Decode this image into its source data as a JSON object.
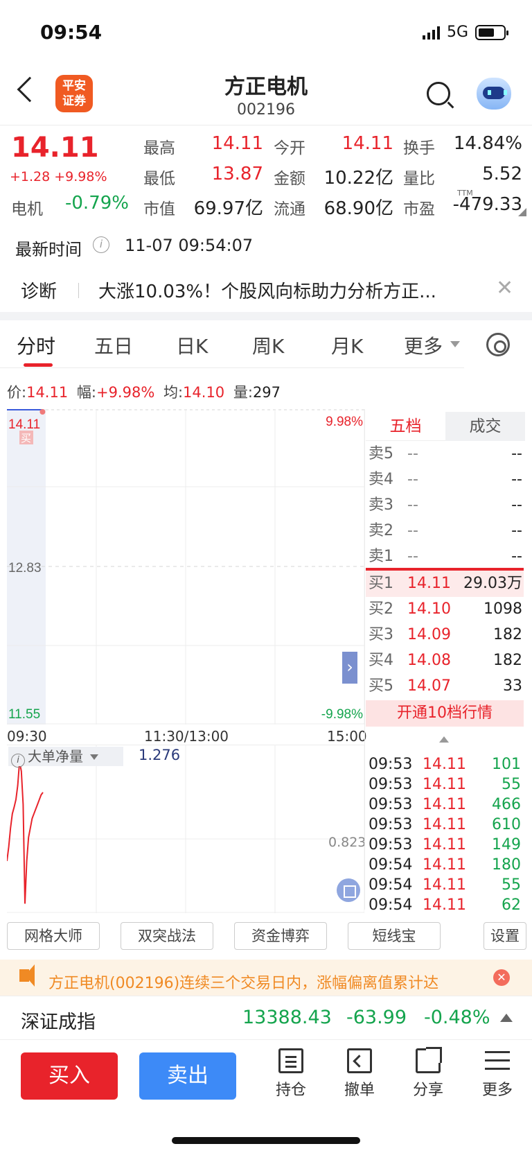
{
  "status_bar": {
    "time": "09:54",
    "network": "5G"
  },
  "header": {
    "logo_text_1": "平安",
    "logo_text_2": "证券",
    "stock_name": "方正电机",
    "stock_code": "002196"
  },
  "quote": {
    "price": "14.11",
    "change": "+1.28 +9.98%",
    "sector_label": "电机",
    "sector_change": "-0.79%",
    "fields": [
      {
        "label": "最高",
        "value": "14.11",
        "color": "#e8232b"
      },
      {
        "label": "今开",
        "value": "14.11",
        "color": "#e8232b"
      },
      {
        "label": "换手",
        "value": "14.84%",
        "color": "#222222"
      },
      {
        "label": "最低",
        "value": "13.87",
        "color": "#e8232b"
      },
      {
        "label": "金额",
        "value": "10.22亿",
        "color": "#222222"
      },
      {
        "label": "量比",
        "value": "5.52",
        "color": "#222222"
      },
      {
        "label": "市值",
        "value": "69.97亿",
        "color": "#222222"
      },
      {
        "label": "流通",
        "value": "68.90亿",
        "color": "#222222"
      },
      {
        "label": "市盈",
        "value": "-479.33",
        "color": "#222222"
      }
    ],
    "pe_superscript": "TTM"
  },
  "latest": {
    "label": "最新时间",
    "time": "11-07 09:54:07"
  },
  "diagnosis": {
    "label": "诊断",
    "text": "大涨10.03%！个股风向标助力分析方正..."
  },
  "tabs": [
    {
      "label": "分时",
      "active": true
    },
    {
      "label": "五日"
    },
    {
      "label": "日K"
    },
    {
      "label": "周K"
    },
    {
      "label": "月K"
    },
    {
      "label": "更多"
    }
  ],
  "infobar": {
    "price_label": "价:",
    "price_value": "14.11",
    "range_label": "幅:",
    "range_value": "+9.98%",
    "avg_label": "均:",
    "avg_value": "14.10",
    "vol_label": "量:",
    "vol_value": "297"
  },
  "chart_data": {
    "type": "line",
    "y_top": "14.11",
    "y_mid": "12.83",
    "y_bottom": "11.55",
    "pct_top": "9.98%",
    "pct_bottom": "-9.98%",
    "buy_marker": "买",
    "ylim": [
      11.55,
      14.11
    ],
    "x_labels": [
      "09:30",
      "11:30/13:00",
      "15:00"
    ],
    "series": [
      {
        "x": [
          0,
          1,
          2,
          3,
          4,
          5,
          6,
          7,
          8,
          9,
          10,
          11,
          12,
          13,
          14,
          15,
          16,
          17,
          18,
          19,
          20,
          21,
          22,
          23,
          24
        ],
        "values": [
          14.11,
          14.11,
          14.11,
          14.11,
          14.11,
          14.11,
          14.11,
          14.11,
          14.11,
          14.11,
          14.11,
          14.11,
          14.11,
          14.11,
          14.11,
          14.11,
          14.11,
          14.11,
          14.11,
          14.11,
          14.11,
          14.11,
          14.11,
          14.11,
          14.11
        ]
      }
    ],
    "sub_chart": {
      "indicator": "大单净量",
      "value": "1.276",
      "axis_value": "0.823",
      "values": [
        0.55,
        0.7,
        0.9,
        1.05,
        1.12,
        1.2,
        1.35,
        1.6,
        1.5,
        1.15,
        0.1,
        0.55,
        0.8,
        0.9,
        1.0,
        1.05,
        1.1,
        1.15,
        1.2,
        1.25,
        1.276
      ],
      "ylim": [
        0.0,
        1.7
      ]
    }
  },
  "orderbook": {
    "tab_active": "五档",
    "tab_other": "成交",
    "asks": [
      {
        "label": "卖5",
        "price": "--",
        "vol": "--"
      },
      {
        "label": "卖4",
        "price": "--",
        "vol": "--"
      },
      {
        "label": "卖3",
        "price": "--",
        "vol": "--"
      },
      {
        "label": "卖2",
        "price": "--",
        "vol": "--"
      },
      {
        "label": "卖1",
        "price": "--",
        "vol": "--"
      }
    ],
    "bids": [
      {
        "label": "买1",
        "price": "14.11",
        "vol": "29.03万"
      },
      {
        "label": "买2",
        "price": "14.10",
        "vol": "1098"
      },
      {
        "label": "买3",
        "price": "14.09",
        "vol": "182"
      },
      {
        "label": "买4",
        "price": "14.08",
        "vol": "182"
      },
      {
        "label": "买5",
        "price": "14.07",
        "vol": "33"
      }
    ],
    "open10": "开通10档行情"
  },
  "trades": [
    {
      "time": "09:53",
      "price": "14.11",
      "vol": "101"
    },
    {
      "time": "09:53",
      "price": "14.11",
      "vol": "55"
    },
    {
      "time": "09:53",
      "price": "14.11",
      "vol": "466"
    },
    {
      "time": "09:53",
      "price": "14.11",
      "vol": "610"
    },
    {
      "time": "09:53",
      "price": "14.11",
      "vol": "149"
    },
    {
      "time": "09:54",
      "price": "14.11",
      "vol": "180"
    },
    {
      "time": "09:54",
      "price": "14.11",
      "vol": "55"
    },
    {
      "time": "09:54",
      "price": "14.11",
      "vol": "62"
    }
  ],
  "tools": [
    "网格大师",
    "双突战法",
    "资金博弈",
    "短线宝",
    "设置"
  ],
  "notice": {
    "text": "方正电机(002196)连续三个交易日内，涨幅偏离值累计达"
  },
  "index": {
    "name": "深证成指",
    "value": "13388.43",
    "change": "-63.99",
    "pct": "-0.48%"
  },
  "bottom": {
    "buy": "买入",
    "sell": "卖出",
    "nav": [
      {
        "label": "持仓"
      },
      {
        "label": "撤单"
      },
      {
        "label": "分享"
      },
      {
        "label": "更多"
      }
    ]
  },
  "colors": {
    "up": "#e8232b",
    "down": "#14a44d",
    "accent_blue": "#3d8af7",
    "avg_line": "#e8b21a"
  }
}
